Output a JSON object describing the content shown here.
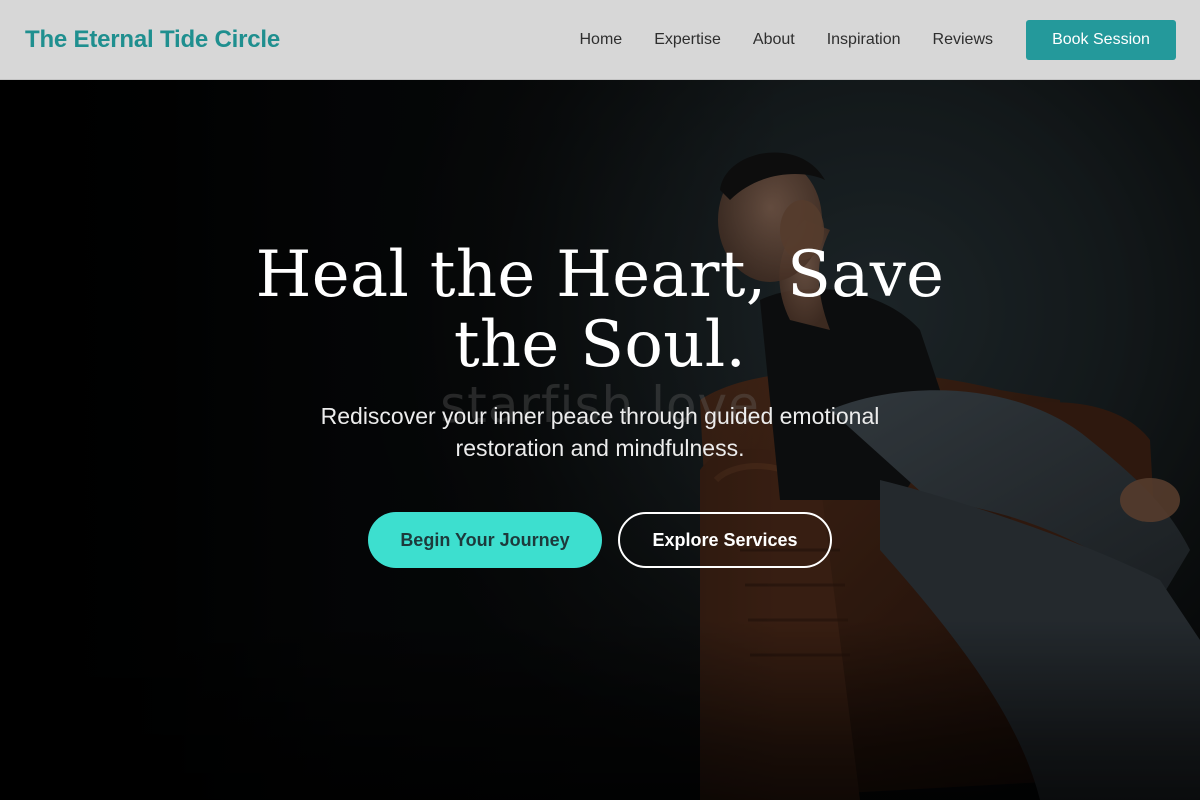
{
  "header": {
    "brand": "The Eternal Tide Circle",
    "nav": [
      {
        "label": "Home"
      },
      {
        "label": "Expertise"
      },
      {
        "label": "About"
      },
      {
        "label": "Inspiration"
      },
      {
        "label": "Reviews"
      }
    ],
    "cta_label": "Book Session"
  },
  "hero": {
    "title": "Heal the Heart, Save the Soul.",
    "subtitle": "Rediscover your inner peace through guided emotional restoration and mindfulness.",
    "watermark": "starfish love",
    "primary_button": "Begin Your Journey",
    "secondary_button": "Explore Services",
    "image_icon": "man-on-leather-chair-image"
  },
  "colors": {
    "brand": "#1f8f8f",
    "cta": "#24999b",
    "primary_button": "#3ddfcf",
    "header_bg": "#d7d7d7"
  }
}
